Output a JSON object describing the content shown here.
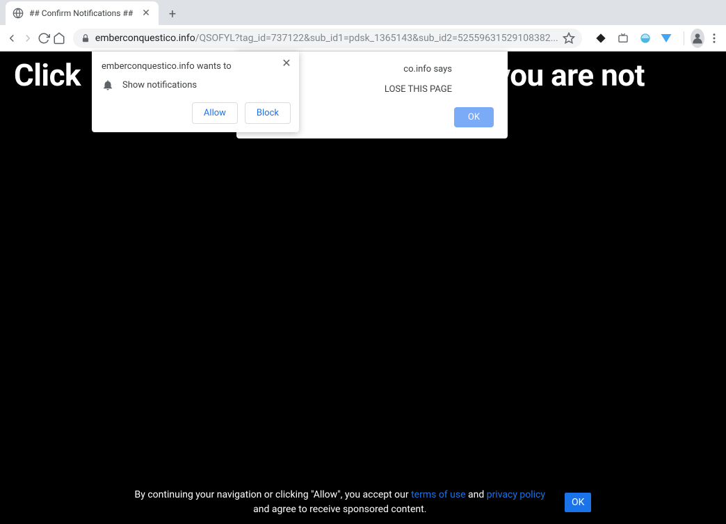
{
  "window": {
    "tab_title": "## Confirm Notifications ##"
  },
  "address": {
    "host": "emberconquestico.info",
    "path": "/QSOFYL?tag_id=737122&sub_id1=pdsk_1365143&sub_id2=52559631529108382..."
  },
  "page": {
    "headline_left": "Click",
    "headline_right": "you are not"
  },
  "perm": {
    "title": "emberconquestico.info wants to",
    "row_text": "Show notifications",
    "allow": "Allow",
    "block": "Block"
  },
  "alert": {
    "title_suffix": "co.info says",
    "message_suffix": "LOSE THIS PAGE",
    "ok": "OK"
  },
  "consent": {
    "line1_a": "By continuing your navigation or clicking \"Allow\", you accept our ",
    "terms": "terms of use",
    "and": " and ",
    "privacy": "privacy policy",
    "line2": "and agree to receive sponsored content.",
    "ok": "OK"
  }
}
